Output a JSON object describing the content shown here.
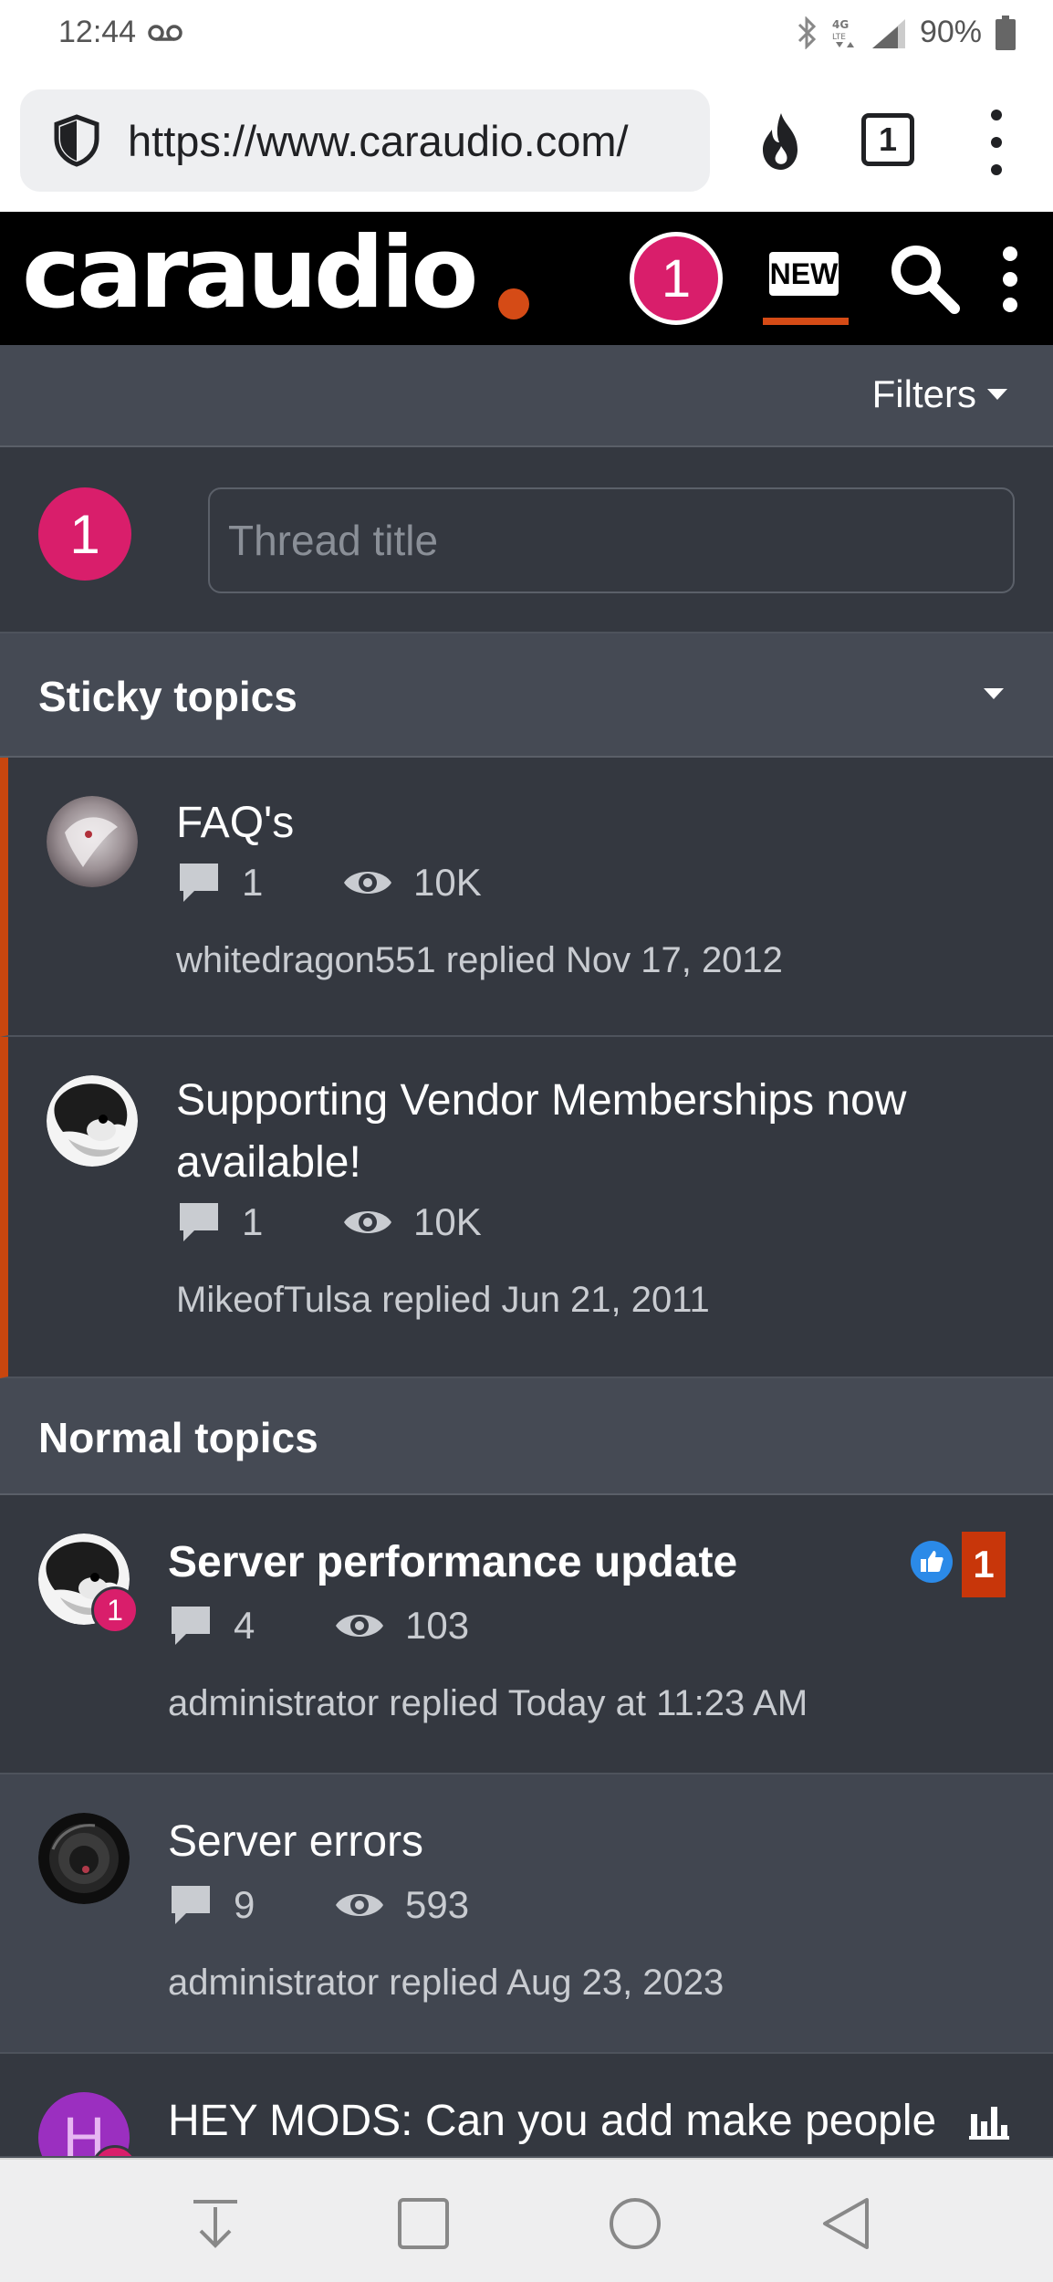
{
  "status_bar": {
    "time": "12:44",
    "battery": "90%",
    "network": "4G LTE"
  },
  "browser": {
    "url": "https://www.caraudio.com/",
    "tab_count": "1",
    "icons": [
      "shield-icon",
      "fire-icon",
      "tabs-icon",
      "more-icon"
    ]
  },
  "site_header": {
    "logo_text": "caraudio",
    "alert_count": "1",
    "new_label": "NEW",
    "accent_color": "#d54b16",
    "alert_color": "#d91e6b"
  },
  "filters": {
    "label": "Filters"
  },
  "new_thread": {
    "avatar_letter": "1",
    "placeholder": "Thread title"
  },
  "sticky": {
    "header": "Sticky topics",
    "threads": [
      {
        "title": "FAQ's",
        "replies": "1",
        "views": "10K",
        "meta": "whitedragon551 replied Nov 17, 2012"
      },
      {
        "title": "Supporting Vendor Memberships now available!",
        "replies": "1",
        "views": "10K",
        "meta": "MikeofTulsa replied Jun 21, 2011"
      }
    ]
  },
  "normal": {
    "header": "Normal topics",
    "threads": [
      {
        "title": "Server performance update",
        "replies": "4",
        "views": "103",
        "meta": "administrator replied Today at 11:23 AM",
        "unread_badge": "1",
        "count_badge": "1"
      },
      {
        "title": "Server errors",
        "replies": "9",
        "views": "593",
        "meta": "administrator replied Aug 23, 2023"
      },
      {
        "title": "HEY MODS: Can you add make people",
        "avatar_letter": "H"
      }
    ]
  },
  "nav_bar": {
    "buttons": [
      "download-icon",
      "recents-icon",
      "home-icon",
      "back-icon"
    ]
  }
}
